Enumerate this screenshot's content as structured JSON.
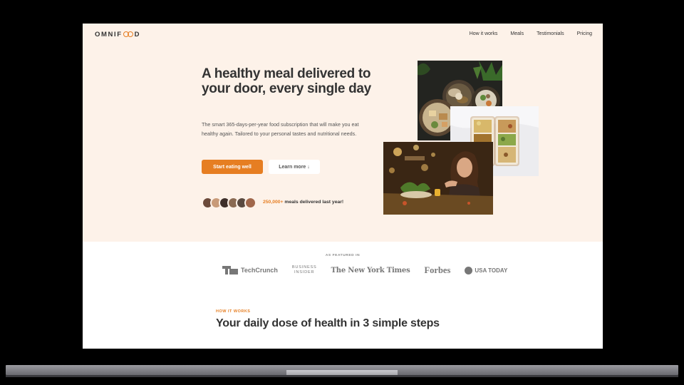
{
  "logo": {
    "prefix": "OMNIF",
    "suffix": "D"
  },
  "nav": {
    "items": [
      "How it works",
      "Meals",
      "Testimonials",
      "Pricing"
    ]
  },
  "hero": {
    "headline": "A healthy meal delivered to your door, every single day",
    "description": "The smart 365-days-per-year food subscription that will make you eat healthy again. Tailored to your personal tastes and nutritional needs.",
    "cta_primary": "Start eating well",
    "cta_secondary": "Learn more ↓",
    "delivered_count": "250,000+",
    "delivered_text": " meals delivered last year!",
    "avatar_colors": [
      "#6b4a3a",
      "#c89a78",
      "#3e2f2a",
      "#8a6a52",
      "#5a4a40",
      "#a0674b"
    ]
  },
  "featured": {
    "label": "AS FEATURED IN",
    "techcrunch": "TechCrunch",
    "business_insider_line1": "BUSINESS",
    "business_insider_line2": "INSIDER",
    "nyt": "The New York Times",
    "forbes": "Forbes",
    "usatoday": "USA TODAY"
  },
  "how": {
    "label": "HOW IT WORKS",
    "title": "Your daily dose of health in 3 simple steps"
  },
  "colors": {
    "accent": "#e67e22",
    "hero_bg": "#fdf2e9",
    "text": "#333333"
  }
}
